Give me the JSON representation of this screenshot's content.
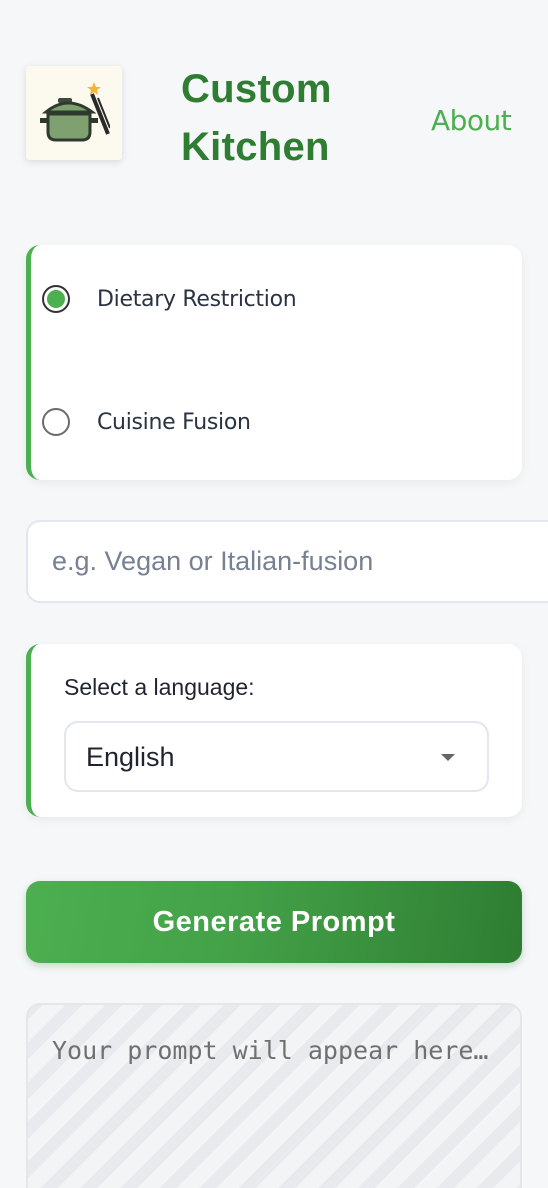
{
  "header": {
    "brand_line1": "Custom",
    "brand_line2": "Kitchen",
    "about_label": "About",
    "logo_icon": "cooking-pot-magic-wand-icon"
  },
  "mode": {
    "options": [
      {
        "label": "Dietary Restriction",
        "checked": true
      },
      {
        "label": "Cuisine Fusion",
        "checked": false
      }
    ]
  },
  "input": {
    "placeholder": "e.g. Vegan or Italian-fusion",
    "value": ""
  },
  "language": {
    "label": "Select a language:",
    "selected": "English"
  },
  "actions": {
    "generate_label": "Generate Prompt"
  },
  "output": {
    "placeholder": "Your prompt will appear here…"
  },
  "colors": {
    "accent": "#4caf50",
    "brand": "#2e7d32",
    "background": "#f6f7f9"
  }
}
